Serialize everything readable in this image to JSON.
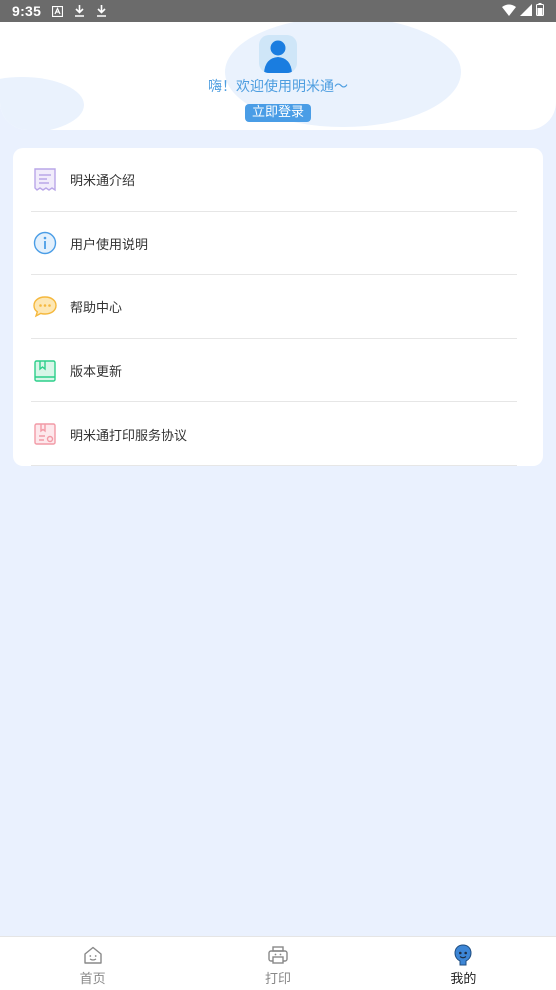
{
  "status_bar": {
    "time": "9:35",
    "icons": [
      "a-icon",
      "download-icon",
      "download-icon",
      "wifi-icon",
      "signal-icon",
      "battery-icon"
    ]
  },
  "header": {
    "welcome": "嗨！欢迎使用明米通～",
    "login_label": "立即登录"
  },
  "menu": {
    "items": [
      {
        "label": "明米通介绍",
        "icon": "receipt-icon",
        "color": "#b9a6e8"
      },
      {
        "label": "用户使用说明",
        "icon": "info-icon",
        "color": "#4a9de6"
      },
      {
        "label": "帮助中心",
        "icon": "chat-bubble-icon",
        "color": "#f5b83d"
      },
      {
        "label": "版本更新",
        "icon": "book-icon",
        "color": "#2ccf8a"
      },
      {
        "label": "明米通打印服务协议",
        "icon": "document-icon",
        "color": "#f29aa6"
      }
    ]
  },
  "tabbar": {
    "tabs": [
      {
        "label": "首页",
        "icon": "home-icon"
      },
      {
        "label": "打印",
        "icon": "printer-icon"
      },
      {
        "label": "我的",
        "icon": "profile-icon",
        "active": true
      }
    ]
  },
  "colors": {
    "accent": "#4a9de6",
    "background": "#eaf1fe",
    "status_bar": "#6b6b6b"
  }
}
